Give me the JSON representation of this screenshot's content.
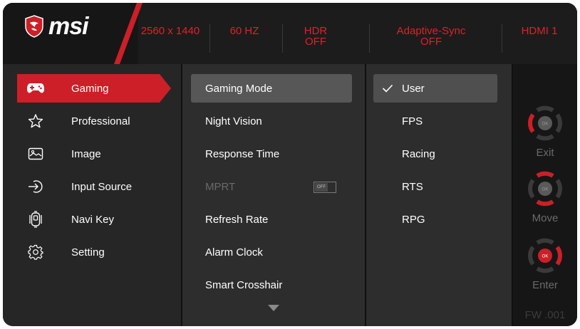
{
  "brand": {
    "name": "msi"
  },
  "status_bar": [
    {
      "line1": "2560 x 1440",
      "line2": ""
    },
    {
      "line1": "60 HZ",
      "line2": ""
    },
    {
      "line1": "HDR",
      "line2": "OFF"
    },
    {
      "line1": "Adaptive-Sync",
      "line2": "OFF"
    },
    {
      "line1": "HDMI 1",
      "line2": ""
    }
  ],
  "main_menu": [
    {
      "label": "Gaming",
      "icon": "gamepad-icon",
      "active": true
    },
    {
      "label": "Professional",
      "icon": "star-icon",
      "active": false
    },
    {
      "label": "Image",
      "icon": "image-icon",
      "active": false
    },
    {
      "label": "Input Source",
      "icon": "input-source-icon",
      "active": false
    },
    {
      "label": "Navi Key",
      "icon": "navi-key-icon",
      "active": false
    },
    {
      "label": "Setting",
      "icon": "gear-icon",
      "active": false
    }
  ],
  "gaming_submenu": [
    {
      "label": "Gaming Mode",
      "selected": true
    },
    {
      "label": "Night Vision"
    },
    {
      "label": "Response Time"
    },
    {
      "label": "MPRT",
      "disabled": true,
      "toggle": "OFF"
    },
    {
      "label": "Refresh Rate"
    },
    {
      "label": "Alarm Clock"
    },
    {
      "label": "Smart Crosshair"
    }
  ],
  "gaming_mode_options": [
    {
      "label": "User",
      "checked": true
    },
    {
      "label": "FPS"
    },
    {
      "label": "Racing"
    },
    {
      "label": "RTS"
    },
    {
      "label": "RPG"
    }
  ],
  "navi_hints": [
    {
      "label": "Exit",
      "key_label": "OK"
    },
    {
      "label": "Move",
      "key_label": "OK"
    },
    {
      "label": "Enter",
      "key_label": "OK"
    }
  ],
  "firmware": "FW .001",
  "colors": {
    "accent": "#cc1f27",
    "background": "#101010",
    "panel": "#2d2d2d",
    "text": "#ffffff"
  }
}
